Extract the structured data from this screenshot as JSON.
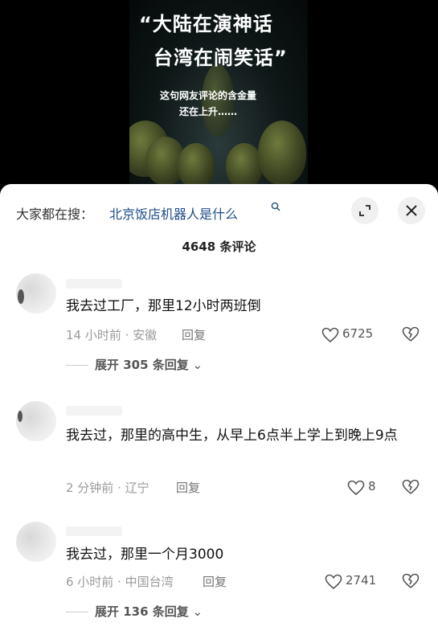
{
  "video": {
    "quote_line1": "“大陆在演神话",
    "quote_line2": "台湾在闹笑话”",
    "sub_line1": "这句网友评论的含金量",
    "sub_line2": "还在上升……"
  },
  "hot_search": {
    "prefix": "大家都在搜：",
    "query": "北京饭店机器人是什么",
    "icon": "search-icon"
  },
  "header": {
    "expand_icon": "expand-icon",
    "close_icon": "close-icon",
    "comment_count": "4648 条评论"
  },
  "comments": [
    {
      "text": "我去过工厂，那里12小时两班倒",
      "time_location": "14 小时前 · 安徽",
      "reply_label": "回复",
      "likes": "6725",
      "expand_label": "展开 305 条回复"
    },
    {
      "text": "我去过，那里的高中生，从早上6点半上学上到晚上9点",
      "time_location": "2 分钟前 · 辽宁",
      "reply_label": "回复",
      "likes": "8"
    },
    {
      "text": "我去过，那里一个月3000",
      "time_location": "6 小时前 · 中国台湾",
      "reply_label": "回复",
      "likes": "2741",
      "expand_label": "展开 136 条回复"
    }
  ],
  "colors": {
    "link": "#1f4c8a",
    "meta": "#9a9a9a",
    "sheet_bg": "#ffffff"
  }
}
